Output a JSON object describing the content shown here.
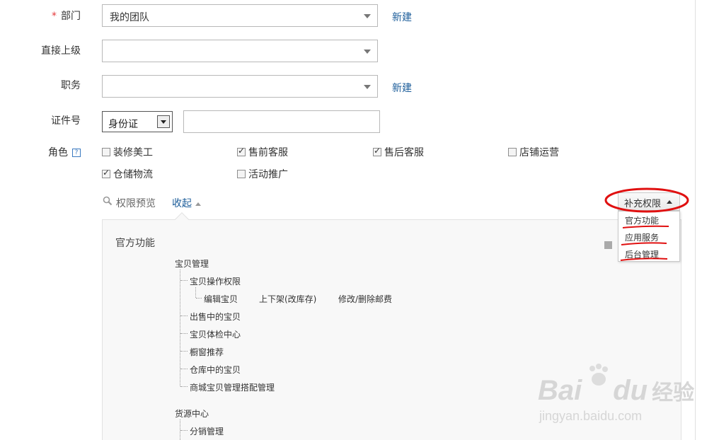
{
  "form": {
    "department": {
      "label": "部门",
      "value": "我的团队",
      "new_link": "新建"
    },
    "superior": {
      "label": "直接上级",
      "value": ""
    },
    "position": {
      "label": "职务",
      "value": "",
      "new_link": "新建"
    },
    "id_number": {
      "label": "证件号",
      "id_type": "身份证",
      "value": ""
    },
    "role": {
      "label": "角色",
      "help": "?",
      "options": [
        {
          "label": "装修美工",
          "checked": false
        },
        {
          "label": "售前客服",
          "checked": true
        },
        {
          "label": "售后客服",
          "checked": true
        },
        {
          "label": "店铺运营",
          "checked": false
        },
        {
          "label": "仓储物流",
          "checked": true
        },
        {
          "label": "活动推广",
          "checked": false
        }
      ]
    }
  },
  "permissions": {
    "preview_label": "权限预览",
    "collapse_label": "收起",
    "section_title": "官方功能",
    "tree": {
      "g1": "宝贝管理",
      "g1_sub1": "宝贝操作权限",
      "g1_sub1_leaves": [
        "编辑宝贝",
        "上下架(改库存)",
        "修改/删除邮费"
      ],
      "g1_items": [
        "出售中的宝贝",
        "宝贝体检中心",
        "橱窗推荐",
        "仓库中的宝贝",
        "商城宝贝管理搭配管理"
      ],
      "g2": "货源中心",
      "g2_items": [
        "分销管理"
      ]
    }
  },
  "supplement": {
    "button_label": "补充权限",
    "menu": [
      "官方功能",
      "应用服务",
      "后台管理"
    ]
  },
  "watermark": {
    "brand": "Bai",
    "brand2": "du",
    "cn": "经验",
    "url": "jingyan.baidu.com"
  },
  "colors": {
    "link": "#1c5d9a",
    "required": "#e4393c",
    "annotation": "#e01010"
  }
}
